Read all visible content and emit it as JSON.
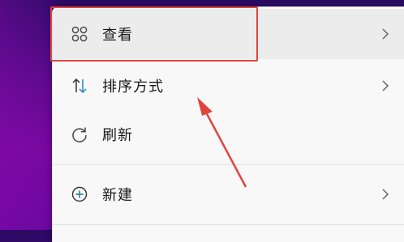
{
  "context_menu": {
    "items": [
      {
        "label": "查看",
        "icon": "grid-view-icon",
        "has_submenu": true
      },
      {
        "label": "排序方式",
        "icon": "sort-arrows-icon",
        "has_submenu": true
      },
      {
        "label": "刷新",
        "icon": "refresh-icon",
        "has_submenu": false
      },
      {
        "label": "新建",
        "icon": "plus-circle-icon",
        "has_submenu": true
      }
    ]
  },
  "colors": {
    "highlight": "#e0443e",
    "arrow": "#e0443e",
    "sort_icon": "#1e88c8"
  }
}
